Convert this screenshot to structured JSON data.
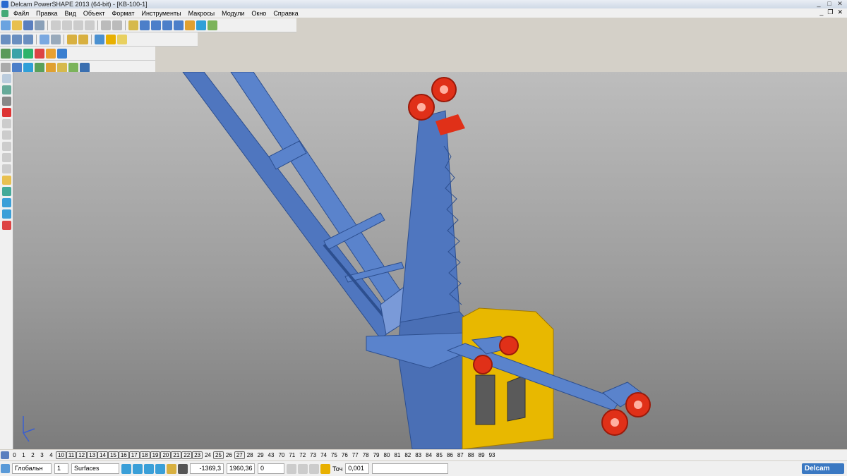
{
  "window": {
    "title": "Delcam PowerSHAPE 2013 (64-bit) - [KB-100-1]"
  },
  "menu": [
    "Файл",
    "Правка",
    "Вид",
    "Объект",
    "Формат",
    "Инструменты",
    "Макросы",
    "Модули",
    "Окно",
    "Справка"
  ],
  "toolbar_icons": {
    "row1": [
      "new-icon",
      "open-icon",
      "save-icon",
      "print-icon",
      "cut-icon",
      "copy-icon",
      "paste-icon",
      "delete-icon",
      "undo-icon",
      "redo-icon",
      "select-icon",
      "line-icon",
      "arc-icon",
      "circle-icon",
      "curve-icon",
      "surface-icon",
      "solid-icon",
      "tools-icon"
    ],
    "row2": [
      "view-front-icon",
      "view-top-icon",
      "view-iso-icon",
      "shade-icon",
      "wireframe-icon",
      "zoom-in-icon",
      "zoom-out-icon",
      "rotate-icon",
      "pan-icon",
      "light-icon"
    ],
    "row3": [
      "workplane-icon",
      "axis-icon",
      "render-icon",
      "material-icon",
      "texture-icon",
      "grid-icon"
    ]
  },
  "levels": [
    "0",
    "1",
    "2",
    "3",
    "4",
    "10",
    "11",
    "12",
    "13",
    "14",
    "15",
    "16",
    "17",
    "18",
    "19",
    "20",
    "21",
    "22",
    "23",
    "24",
    "25",
    "26",
    "27",
    "28",
    "29",
    "43",
    "70",
    "71",
    "72",
    "73",
    "74",
    "75",
    "76",
    "77",
    "78",
    "79",
    "80",
    "81",
    "82",
    "83",
    "84",
    "85",
    "86",
    "87",
    "88",
    "89",
    "93"
  ],
  "levels_boxed": [
    "10",
    "11",
    "12",
    "13",
    "14",
    "15",
    "16",
    "17",
    "18",
    "19",
    "20",
    "21",
    "22",
    "23",
    "25",
    "27"
  ],
  "status": {
    "workplane": "Глобальн",
    "level": "1",
    "object_type": "Surfaces",
    "x": "-1369,3",
    "y": "1960,36",
    "z": "0",
    "tolerance_label": "Точ",
    "tolerance": "0,001"
  },
  "brand": "Delcam",
  "colors": {
    "boom": "#4f76bf",
    "cabin": "#e8b800",
    "wheels": "#e03018",
    "background_top": "#bdbdbd",
    "background_bottom": "#7c7c7c"
  }
}
